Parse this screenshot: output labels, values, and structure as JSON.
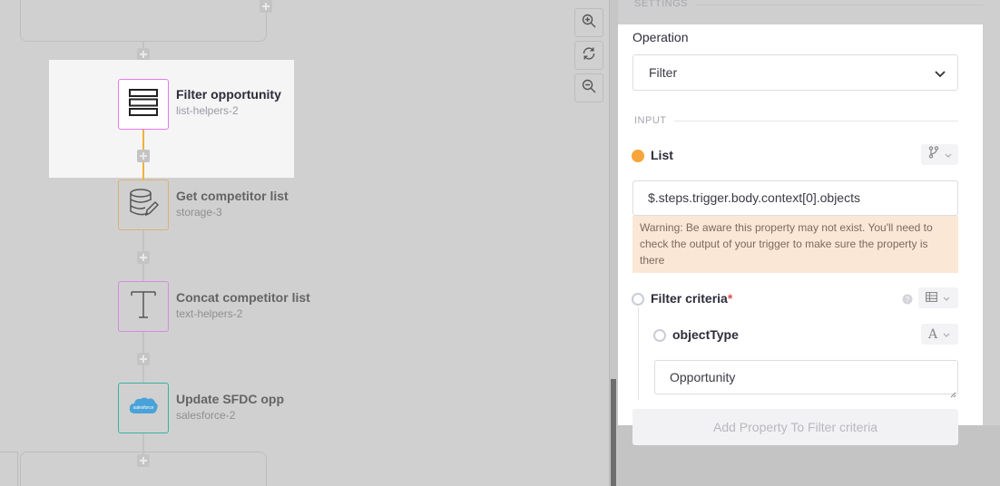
{
  "canvas": {
    "nodes": [
      {
        "title": "Filter opportunity",
        "subtitle": "list-helpers-2",
        "icon": "list-stack-icon",
        "color": "#e27ce6",
        "selected": true
      },
      {
        "title": "Get competitor list",
        "subtitle": "storage-3",
        "icon": "database-edit-icon",
        "color": "#d6b37a",
        "selected": false
      },
      {
        "title": "Concat competitor list",
        "subtitle": "text-helpers-2",
        "icon": "text-t-icon",
        "color": "#d58ae0",
        "selected": false
      },
      {
        "title": "Update SFDC opp",
        "subtitle": "salesforce-2",
        "icon": "salesforce-cloud-icon",
        "color": "#39b3a0",
        "selected": false
      }
    ],
    "zoom_controls": [
      "zoom-in-icon",
      "reset-icon",
      "zoom-out-icon"
    ],
    "salesforce_logo_text": "salesforce"
  },
  "panel": {
    "settings_label": "SETTINGS",
    "operation_label": "Operation",
    "operation_value": "Filter",
    "input_label": "INPUT",
    "list_label": "List",
    "list_value": "$.steps.trigger.body.context[0].objects",
    "warning_text": "Warning: Be aware this property may not exist. You'll need to check the output of your trigger to make sure the property is there",
    "filter_criteria_label": "Filter criteria",
    "required_mark": "*",
    "object_type_label": "objectType",
    "object_type_type": "A",
    "object_type_value": "Opportunity",
    "add_property_label": "Add Property To Filter criteria"
  },
  "colors": {
    "orange_dot": "#f6a53a",
    "selected_border": "#e27ce6",
    "connector": "#f2b23a",
    "warning_bg": "#fbe7d6"
  }
}
